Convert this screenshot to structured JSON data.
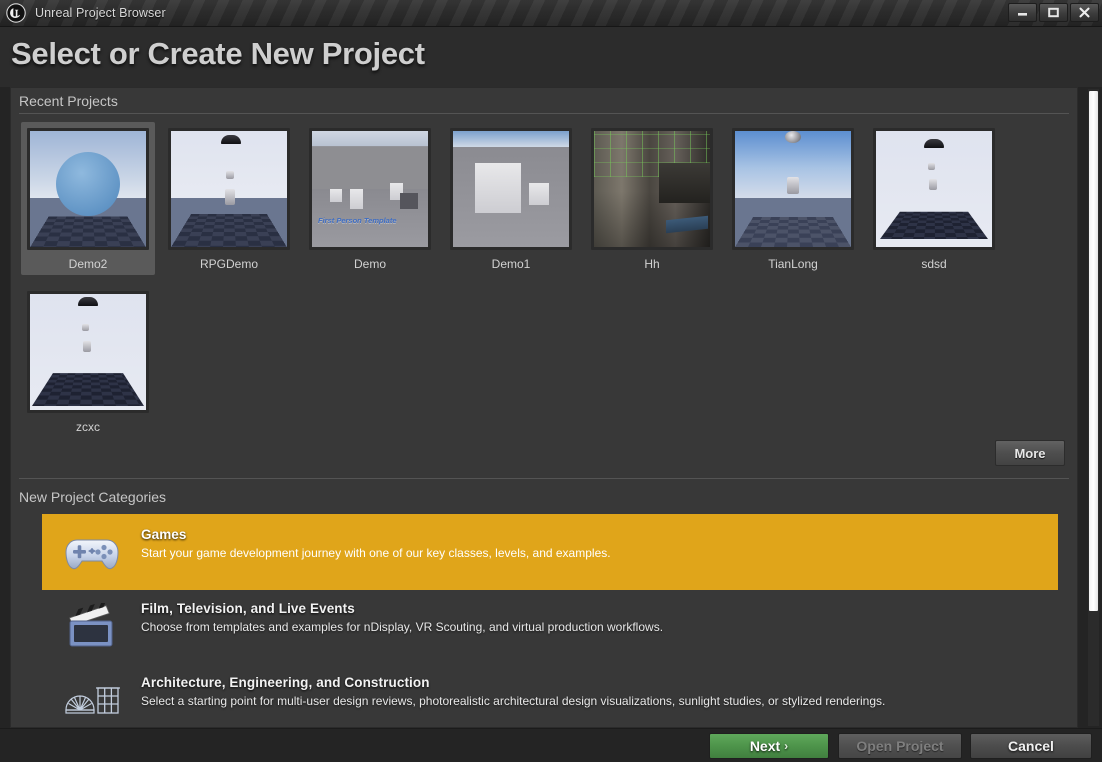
{
  "window": {
    "title": "Unreal Project Browser",
    "logo_icon": "unreal-engine-logo",
    "controls": {
      "minimize_icon": "minimize-icon",
      "maximize_icon": "maximize-icon",
      "close_icon": "close-icon"
    }
  },
  "header": {
    "page_title": "Select or Create New Project"
  },
  "recent_projects": {
    "section_label": "Recent Projects",
    "more_label": "More",
    "items": [
      {
        "name": "Demo2",
        "selected": true,
        "scene": "sphere-on-checker-floor"
      },
      {
        "name": "RPGDemo",
        "selected": false,
        "scene": "checker-floor-parachute"
      },
      {
        "name": "Demo",
        "selected": false,
        "scene": "first-person-template",
        "overlay_text": "First Person Template"
      },
      {
        "name": "Demo1",
        "selected": false,
        "scene": "grey-blockout"
      },
      {
        "name": "Hh",
        "selected": false,
        "scene": "photoreal-courtyard"
      },
      {
        "name": "TianLong",
        "selected": false,
        "scene": "blue-sky-mannequin"
      },
      {
        "name": "sdsd",
        "selected": false,
        "scene": "dark-checker-floor"
      },
      {
        "name": "zcxc",
        "selected": false,
        "scene": "dark-checker-floor"
      }
    ]
  },
  "new_project_categories": {
    "section_label": "New Project Categories",
    "items": [
      {
        "title": "Games",
        "description": "Start your game development journey with one of our key classes, levels, and examples.",
        "icon": "gamepad-icon",
        "selected": true
      },
      {
        "title": "Film, Television, and Live Events",
        "description": "Choose from templates and examples for nDisplay, VR Scouting, and virtual production workflows.",
        "icon": "clapperboard-icon",
        "selected": false
      },
      {
        "title": "Architecture, Engineering, and Construction",
        "description": "Select a starting point for multi-user design reviews, photorealistic architectural design visualizations, sunlight studies, or stylized renderings.",
        "icon": "architecture-icon",
        "selected": false
      }
    ]
  },
  "footer": {
    "next_label": "Next",
    "next_arrow": "›",
    "open_project_label": "Open Project",
    "cancel_label": "Cancel"
  },
  "colors": {
    "accent_highlight": "#e0a51a",
    "next_button_green": "#4c9249",
    "panel_background": "#383838",
    "window_background": "#242424"
  },
  "scrollbar": {
    "name": "vertical-scrollbar"
  }
}
